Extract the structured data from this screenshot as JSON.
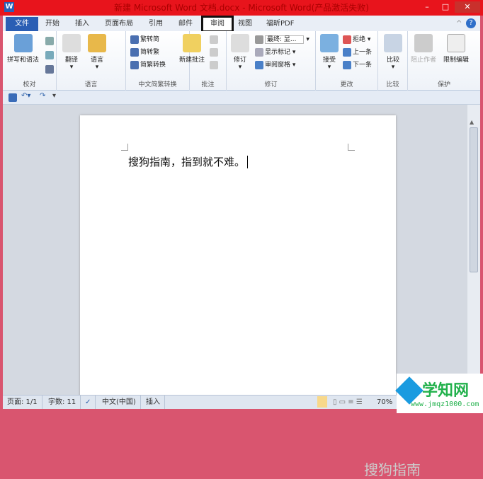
{
  "title": "新建 Microsoft Word 文档.docx - Microsoft Word(产品激活失败)",
  "app_icon": "W",
  "window_controls": {
    "minimize": "–",
    "maximize": "□",
    "close": "✕"
  },
  "tabs": [
    "文件",
    "开始",
    "插入",
    "页面布局",
    "引用",
    "邮件",
    "审阅",
    "视图",
    "福昕PDF"
  ],
  "active_tab": "审阅",
  "groups": {
    "proofing": {
      "label": "校对",
      "spelling": "拼写和语法"
    },
    "language": {
      "label": "语言",
      "translate": "翻译",
      "language": "语言"
    },
    "chinese": {
      "label": "中文简繁转换",
      "t2s": "繁转简",
      "s2t": "简转繁",
      "convert": "简繁转换"
    },
    "comments": {
      "label": "批注",
      "new": "新建批注"
    },
    "tracking": {
      "label": "修订",
      "track": "修订",
      "display": "最终: 显...",
      "markup": "显示标记",
      "pane": "审阅窗格"
    },
    "changes": {
      "label": "更改",
      "accept": "接受",
      "reject": "拒绝",
      "prev": "上一条",
      "next": "下一条"
    },
    "compare": {
      "label": "比较",
      "compare": "比较"
    },
    "protect": {
      "label": "保护",
      "block": "阻止作者",
      "restrict": "限制编辑"
    }
  },
  "document": {
    "text": "搜狗指南，指到就不难。"
  },
  "status": {
    "page": "页面: 1/1",
    "words": "字数: 11",
    "lang": "中文(中国)",
    "mode": "插入",
    "zoom": "70%"
  },
  "watermark": {
    "sogou": "搜狗指南",
    "site": "学知网",
    "url": "www.jmqz1000.com"
  }
}
